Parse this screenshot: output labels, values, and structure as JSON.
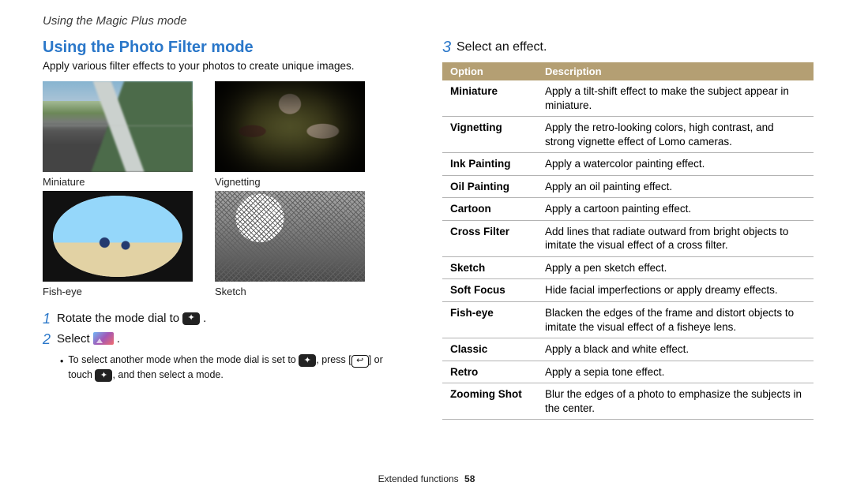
{
  "breadcrumb": "Using the Magic Plus mode",
  "left": {
    "title": "Using the Photo Filter mode",
    "intro": "Apply various filter effects to your photos to create unique images.",
    "thumbs": [
      {
        "label": "Miniature"
      },
      {
        "label": "Vignetting"
      },
      {
        "label": "Fish-eye"
      },
      {
        "label": "Sketch"
      }
    ],
    "step1_num": "1",
    "step1_a": "Rotate the mode dial to",
    "step1_b": ".",
    "step2_num": "2",
    "step2_a": "Select",
    "step2_b": ".",
    "note_bullet": "•",
    "note_a": "To select another mode when the mode dial is set to",
    "note_b": ", press [",
    "note_c": "] or touch",
    "note_d": ", and then select a mode."
  },
  "right": {
    "step3_num": "3",
    "step3_text": "Select an effect.",
    "headers": {
      "opt": "Option",
      "desc": "Description"
    },
    "rows": [
      {
        "opt": "Miniature",
        "desc": "Apply a tilt-shift effect to make the subject appear in miniature."
      },
      {
        "opt": "Vignetting",
        "desc": "Apply the retro-looking colors, high contrast, and strong vignette effect of Lomo cameras."
      },
      {
        "opt": "Ink Painting",
        "desc": "Apply a watercolor painting effect."
      },
      {
        "opt": "Oil Painting",
        "desc": "Apply an oil painting effect."
      },
      {
        "opt": "Cartoon",
        "desc": "Apply a cartoon painting effect."
      },
      {
        "opt": "Cross Filter",
        "desc": "Add lines that radiate outward from bright objects to imitate the visual effect of a cross filter."
      },
      {
        "opt": "Sketch",
        "desc": "Apply a pen sketch effect."
      },
      {
        "opt": "Soft Focus",
        "desc": "Hide facial imperfections or apply dreamy effects."
      },
      {
        "opt": "Fish-eye",
        "desc": "Blacken the edges of the frame and distort objects to imitate the visual effect of a fisheye lens."
      },
      {
        "opt": "Classic",
        "desc": "Apply a black and white effect."
      },
      {
        "opt": "Retro",
        "desc": "Apply a sepia tone effect."
      },
      {
        "opt": "Zooming Shot",
        "desc": "Blur the edges of a photo to emphasize the subjects in the center."
      }
    ]
  },
  "footer": {
    "section": "Extended functions",
    "page": "58"
  },
  "icons": {
    "mode_dial": "✦",
    "return": "↩"
  }
}
